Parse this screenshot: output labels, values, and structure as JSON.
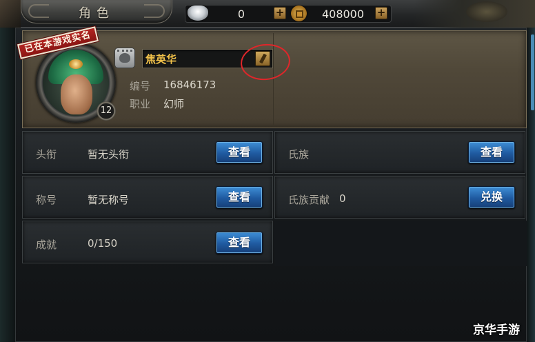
{
  "window": {
    "title": "角色"
  },
  "currency": {
    "silver_icon": "silver-ingot-icon",
    "silver_value": "0",
    "add_silver_label": "+",
    "gold_icon": "coin-icon",
    "gold_value": "408000",
    "add_gold_label": "+"
  },
  "profile": {
    "verified_stamp": "已在本游戏实名",
    "name": "焦英华",
    "level": "12",
    "id_label": "编号",
    "id_value": "16846173",
    "class_label": "职业",
    "class_value": "幻师"
  },
  "rows": [
    {
      "label": "头衔",
      "value": "暂无头衔",
      "button": "查看"
    },
    {
      "label": "氏族",
      "value": "",
      "button": "查看"
    },
    {
      "label": "称号",
      "value": "暂无称号",
      "button": "查看"
    },
    {
      "label": "氏族贡献",
      "value": "0",
      "button": "兑换"
    },
    {
      "label": "成就",
      "value": "0/150",
      "button": "查看"
    }
  ],
  "annotation_color": "#e0262a",
  "watermark": "京华手游"
}
